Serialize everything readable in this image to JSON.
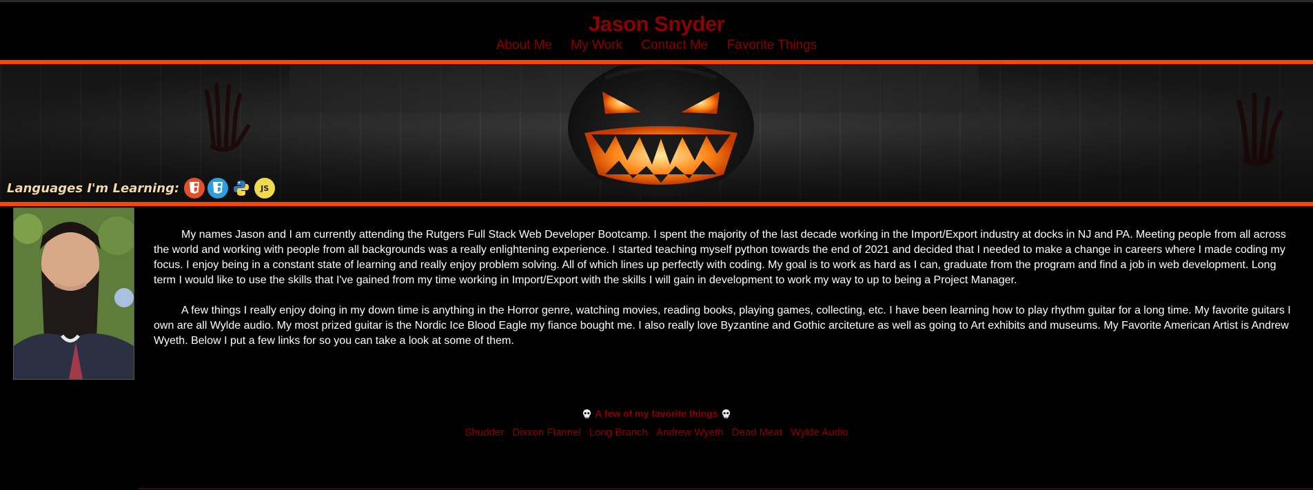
{
  "header": {
    "title": "Jason Snyder",
    "nav": [
      "About Me",
      "My Work",
      "Contact Me",
      "Favorite Things"
    ]
  },
  "banner": {
    "languages_label": "Languages I'm Learning:",
    "languages": [
      {
        "name": "html5-icon",
        "color": "#e34f26"
      },
      {
        "name": "css3-icon",
        "color": "#2f9ee0"
      },
      {
        "name": "python-icon",
        "color": "#3776ab"
      },
      {
        "name": "javascript-icon",
        "color": "#f0db4f",
        "text": "JS"
      }
    ]
  },
  "about": {
    "paragraphs": [
      "My names Jason and I am currently attending the Rutgers Full Stack Web Developer Bootcamp. I spent the majority of the last decade working in the Import/Export industry at docks in NJ and PA. Meeting people from all across the world and working with people from all backgrounds was a really enlightening experience. I started teaching myself python towards the end of 2021 and decided that I needed to make a change in careers where I made coding my focus. I enjoy being in a constant state of learning and really enjoy problem solving. All of which lines up perfectly with coding. My goal is to work as hard as I can, graduate from the program and find a job in web development. Long term I would like to use the skills that I've gained from my time working in Import/Export with the skills I will gain in development to work my way to up to being a Project Manager.",
      "A few things I really enjoy doing in my down time is anything in the Horror genre, watching movies, reading books, playing games, collecting, etc. I have been learning how to play rhythm guitar for a long time. My favorite guitars I own are all Wylde audio. My most prized guitar is the Nordic Ice Blood Eagle my fiance bought me. I also really love Byzantine and Gothic arciteture as well as going to Art exhibits and museums. My Favorite American Artist is Andrew Wyeth. Below I put a few links for so you can take a look at some of them."
    ]
  },
  "favorites": {
    "title": "A few of my favorite things",
    "links": [
      "Shudder",
      "Dixxon Flannel",
      "Long Branch",
      "Andrew Wyeth",
      "Dead Meat",
      "Wylde Audio"
    ]
  },
  "colors": {
    "accent": "#ff4500",
    "brand": "#8b0000",
    "background": "#000000"
  }
}
